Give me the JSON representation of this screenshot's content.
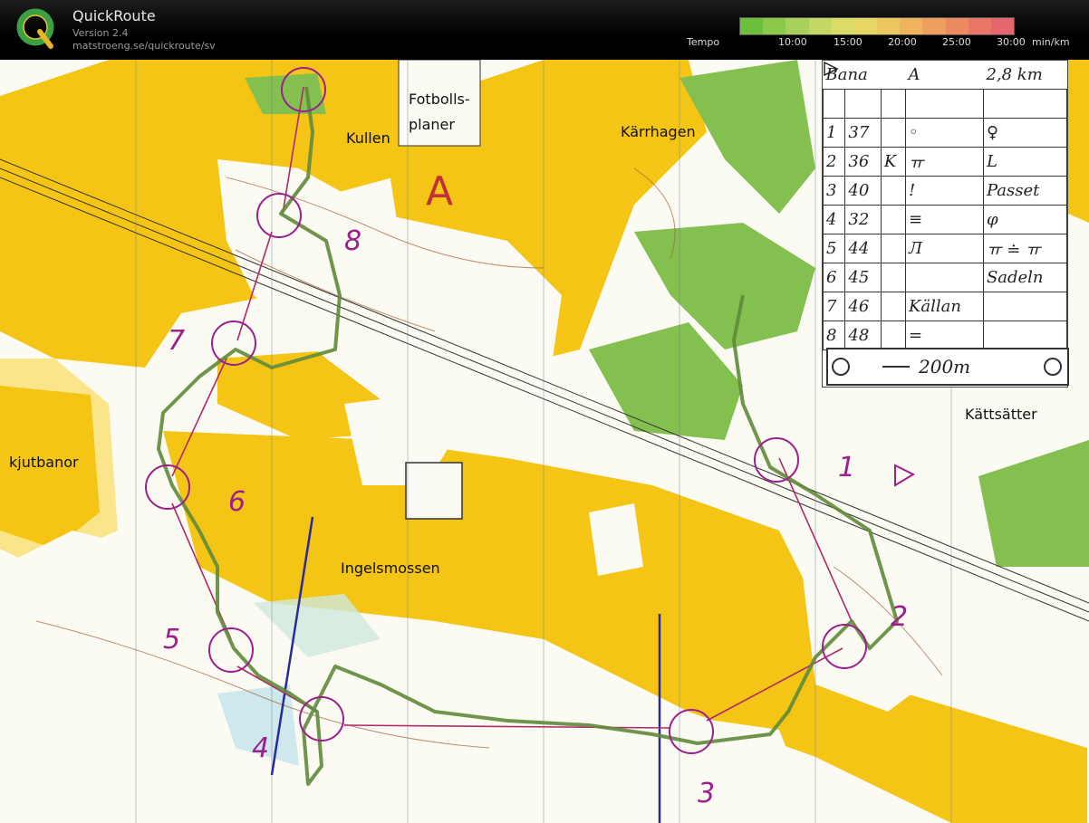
{
  "header": {
    "app_name": "QuickRoute",
    "version": "Version 2.4",
    "url": "matstroeng.se/quickroute/sv",
    "tempo_label": "Tempo",
    "tempo_ticks": [
      "10:00",
      "15:00",
      "20:00",
      "25:00",
      "30:00"
    ],
    "tempo_unit": "min/km",
    "tempo_colors": [
      "#6fbf3f",
      "#8cc84a",
      "#a8d05a",
      "#c4d864",
      "#d9dc66",
      "#e6d764",
      "#ecc75f",
      "#eeb35c",
      "#ee9f5d",
      "#ec8a60",
      "#e97666",
      "#e5666d"
    ]
  },
  "map": {
    "place_names": {
      "fotbollsplaner_1": "Fotbolls-",
      "fotbollsplaner_2": "planer",
      "kullen": "Kullen",
      "karrhagen": "Kärrhagen",
      "kattsatter": "Kättsätter",
      "skjutbanor": "kjutbanor",
      "ingelsmossen": "Ingelsmossen"
    },
    "course_letter": "A",
    "control_numbers": [
      "1",
      "2",
      "3",
      "4",
      "5",
      "6",
      "7",
      "8"
    ],
    "colors": {
      "open": "#f5c516",
      "semi_open": "#fbe58a",
      "forest": "#fbfaf3",
      "green": "#84c04f",
      "control": "#9b1f8e",
      "route": "#5f8a3a"
    },
    "card": {
      "title_1": "Bana",
      "title_2": "A",
      "title_3": "2,8 km",
      "rows": [
        {
          "num": "",
          "code": "",
          "d": "",
          "e": "",
          "g": ""
        },
        {
          "num": "1",
          "code": "37",
          "d": "",
          "e": "◦",
          "g": "♀"
        },
        {
          "num": "2",
          "code": "36",
          "d": "K",
          "e": "ㅠ",
          "g": "L"
        },
        {
          "num": "3",
          "code": "40",
          "d": "",
          "e": "!",
          "g": "Passet"
        },
        {
          "num": "4",
          "code": "32",
          "d": "",
          "e": "≡",
          "g": "φ"
        },
        {
          "num": "5",
          "code": "44",
          "d": "",
          "e": "Л",
          "g": "ㅠ ≐ ㅠ"
        },
        {
          "num": "6",
          "code": "45",
          "d": "",
          "e": "",
          "g": "Sadeln"
        },
        {
          "num": "7",
          "code": "46",
          "d": "",
          "e": "Källan",
          "g": ""
        },
        {
          "num": "8",
          "code": "48",
          "d": "",
          "e": "=",
          "g": ""
        }
      ],
      "distance": "200m"
    }
  }
}
